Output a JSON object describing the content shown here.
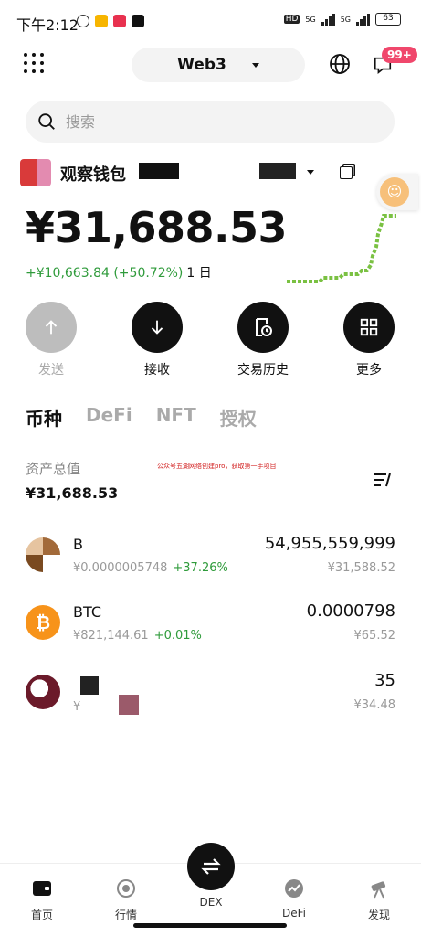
{
  "status_bar": {
    "time": "下午2:12",
    "network1": "5G",
    "network2": "5G",
    "hd": "HD",
    "battery": "63"
  },
  "top_bar": {
    "network_selector": "Web3",
    "notification_badge": "99+"
  },
  "search": {
    "placeholder": "搜索"
  },
  "wallet": {
    "name": "观察钱包",
    "balance": "¥31,688.53",
    "change": "+¥10,663.84 (+50.72%)",
    "period": "1 日"
  },
  "actions": [
    {
      "label": "发送",
      "icon": "arrow-up-icon",
      "enabled": false
    },
    {
      "label": "接收",
      "icon": "arrow-down-icon",
      "enabled": true
    },
    {
      "label": "交易历史",
      "icon": "history-icon",
      "enabled": true
    },
    {
      "label": "更多",
      "icon": "grid-more-icon",
      "enabled": true
    }
  ],
  "tabs": [
    {
      "label": "币种",
      "active": true
    },
    {
      "label": "DeFi",
      "active": false
    },
    {
      "label": "NFT",
      "active": false
    },
    {
      "label": "授权",
      "active": false
    }
  ],
  "assets_summary": {
    "label": "资产总值",
    "value": "¥31,688.53",
    "promo_text": "公众号五湖网络创建pro，获取第一手项目"
  },
  "assets": [
    {
      "name": "B",
      "price": "¥0.0000005748",
      "change": "+37.26%",
      "amount": "54,955,559,999",
      "value": "¥31,588.52"
    },
    {
      "name": "BTC",
      "price": "¥821,144.61",
      "change": "+0.01%",
      "amount": "0.0000798",
      "value": "¥65.52"
    },
    {
      "name": "",
      "price": "¥",
      "change": "",
      "amount": "35",
      "value": "¥34.48"
    }
  ],
  "bottom_nav": [
    {
      "label": "首页",
      "icon": "wallet-icon"
    },
    {
      "label": "行情",
      "icon": "market-icon"
    },
    {
      "label": "DEX",
      "icon": "swap-icon"
    },
    {
      "label": "DeFi",
      "icon": "defi-icon"
    },
    {
      "label": "发现",
      "icon": "telescope-icon"
    }
  ],
  "colors": {
    "positive": "#2f9b3b",
    "badge": "#f0476c",
    "btc": "#f7931a",
    "spark": "#7ac142"
  }
}
